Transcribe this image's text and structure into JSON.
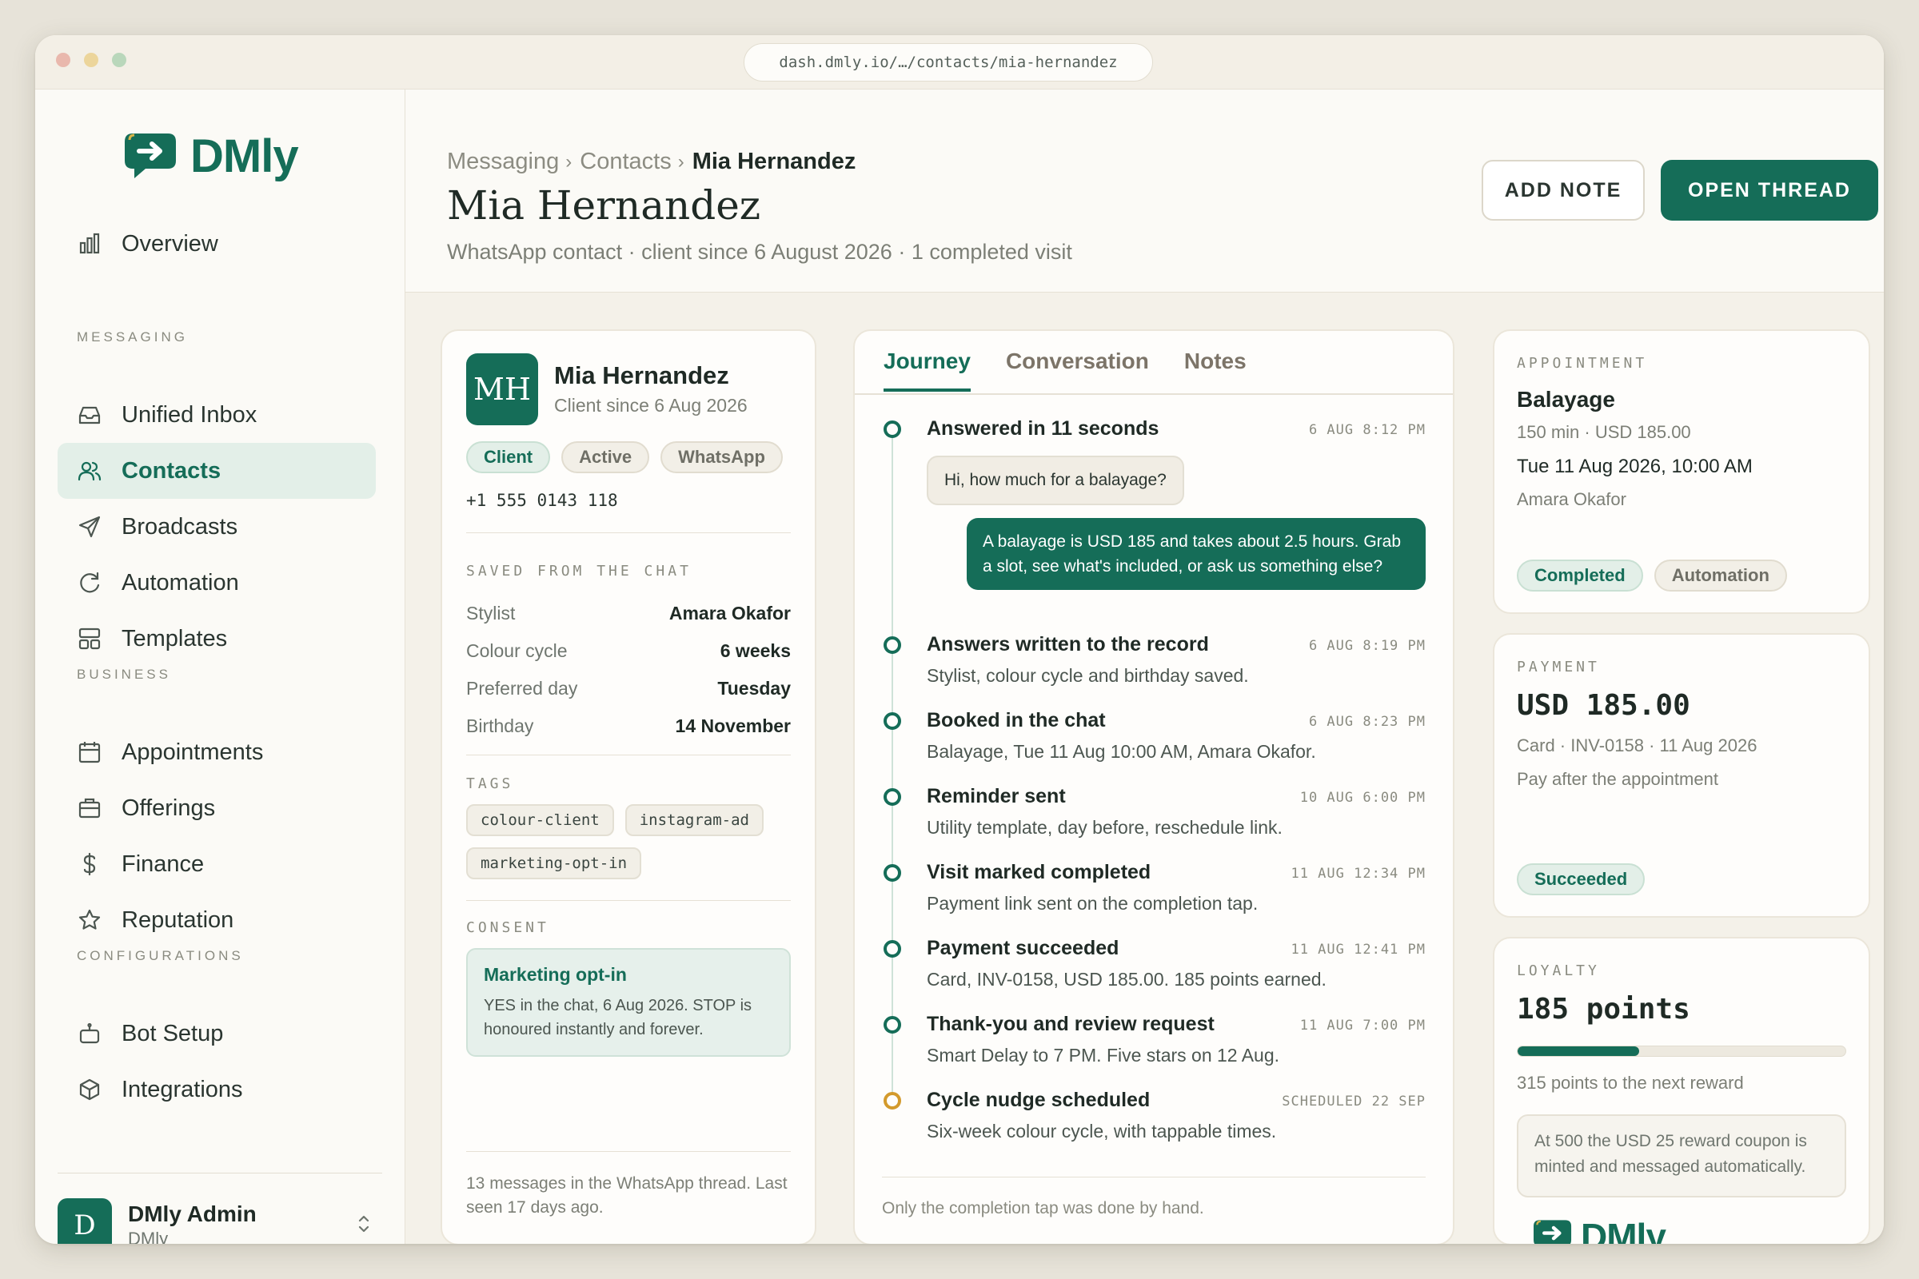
{
  "browser": {
    "url": "dash.dmly.io/…/contacts/mia-hernandez"
  },
  "brand": {
    "name": "DMly",
    "color": "#156d58"
  },
  "sidebar": {
    "overview": {
      "label": "Overview",
      "icon": "bar-chart-icon"
    },
    "sections": {
      "messaging": "MESSAGING",
      "business": "BUSINESS",
      "configurations": "CONFIGURATIONS"
    },
    "messaging_items": [
      {
        "label": "Unified Inbox",
        "icon": "inbox-icon"
      },
      {
        "label": "Contacts",
        "icon": "users-icon",
        "active": true
      },
      {
        "label": "Broadcasts",
        "icon": "send-icon"
      },
      {
        "label": "Automation",
        "icon": "refresh-icon"
      },
      {
        "label": "Templates",
        "icon": "layout-icon"
      }
    ],
    "business_items": [
      {
        "label": "Appointments",
        "icon": "calendar-icon"
      },
      {
        "label": "Offerings",
        "icon": "briefcase-icon"
      },
      {
        "label": "Finance",
        "icon": "dollar-icon"
      },
      {
        "label": "Reputation",
        "icon": "star-icon"
      }
    ],
    "config_items": [
      {
        "label": "Bot Setup",
        "icon": "bot-icon"
      },
      {
        "label": "Integrations",
        "icon": "cube-icon"
      }
    ],
    "user": {
      "initial": "D",
      "name": "DMly Admin",
      "org": "DMly"
    }
  },
  "header": {
    "breadcrumb": [
      "Messaging",
      "Contacts",
      "Mia Hernandez"
    ],
    "title": "Mia Hernandez",
    "subtitle": "WhatsApp contact · client since 6 August 2026 · 1 completed visit",
    "add_note": "ADD NOTE",
    "open_thread": "OPEN THREAD"
  },
  "contact": {
    "initials": "MH",
    "name": "Mia Hernandez",
    "since": "Client since 6 Aug 2026",
    "pills": [
      "Client",
      "Active",
      "WhatsApp"
    ],
    "phone": "+1 555 0143 118",
    "saved_label": "SAVED FROM THE CHAT",
    "fields": [
      {
        "k": "Stylist",
        "v": "Amara Okafor"
      },
      {
        "k": "Colour cycle",
        "v": "6 weeks"
      },
      {
        "k": "Preferred day",
        "v": "Tuesday"
      },
      {
        "k": "Birthday",
        "v": "14 November"
      }
    ],
    "tags_label": "TAGS",
    "tags": [
      "colour-client",
      "instagram-ad",
      "marketing-opt-in"
    ],
    "consent_label": "CONSENT",
    "consent_title": "Marketing opt-in",
    "consent_body": "YES in the chat, 6 Aug 2026. STOP is honoured instantly and forever.",
    "footer": "13 messages in the WhatsApp thread. Last seen 17 days ago."
  },
  "journey": {
    "tabs": [
      "Journey",
      "Conversation",
      "Notes"
    ],
    "events": [
      {
        "title": "Answered in 11 seconds",
        "time": "6 AUG 8:12 PM"
      },
      {
        "title": "Answers written to the record",
        "time": "6 AUG 8:19 PM",
        "desc": "Stylist, colour cycle and birthday saved."
      },
      {
        "title": "Booked in the chat",
        "time": "6 AUG 8:23 PM",
        "desc": "Balayage, Tue 11 Aug 10:00 AM, Amara Okafor."
      },
      {
        "title": "Reminder sent",
        "time": "10 AUG 6:00 PM",
        "desc": "Utility template, day before, reschedule link."
      },
      {
        "title": "Visit marked completed",
        "time": "11 AUG 12:34 PM",
        "desc": "Payment link sent on the completion tap."
      },
      {
        "title": "Payment succeeded",
        "time": "11 AUG 12:41 PM",
        "desc": "Card, INV-0158, USD 185.00. 185 points earned."
      },
      {
        "title": "Thank-you and review request",
        "time": "11 AUG 7:00 PM",
        "desc": "Smart Delay to 7 PM. Five stars on 12 Aug."
      },
      {
        "title": "Cycle nudge scheduled",
        "time": "SCHEDULED 22 SEP",
        "desc": "Six-week colour cycle, with tappable times."
      }
    ],
    "msg_in": "Hi, how much for a balayage?",
    "msg_out": "A balayage is USD 185 and takes about 2.5 hours. Grab a slot, see what's included, or ask us something else?",
    "footer": "Only the completion tap was done by hand."
  },
  "appointment": {
    "label": "APPOINTMENT",
    "service": "Balayage",
    "details": "150 min · USD 185.00",
    "datetime": "Tue 11 Aug 2026, 10:00 AM",
    "staff": "Amara Okafor",
    "pills": [
      "Completed",
      "Automation"
    ]
  },
  "payment": {
    "label": "PAYMENT",
    "amount": "USD 185.00",
    "details": "Card · INV-0158 · 11 Aug 2026",
    "note": "Pay after the appointment",
    "status": "Succeeded"
  },
  "loyalty": {
    "label": "LOYALTY",
    "points": "185 points",
    "progress": 0.37,
    "next": "315 points to the next reward",
    "reward_note": "At 500 the USD 25 reward coupon is minted and messaged automatically."
  }
}
